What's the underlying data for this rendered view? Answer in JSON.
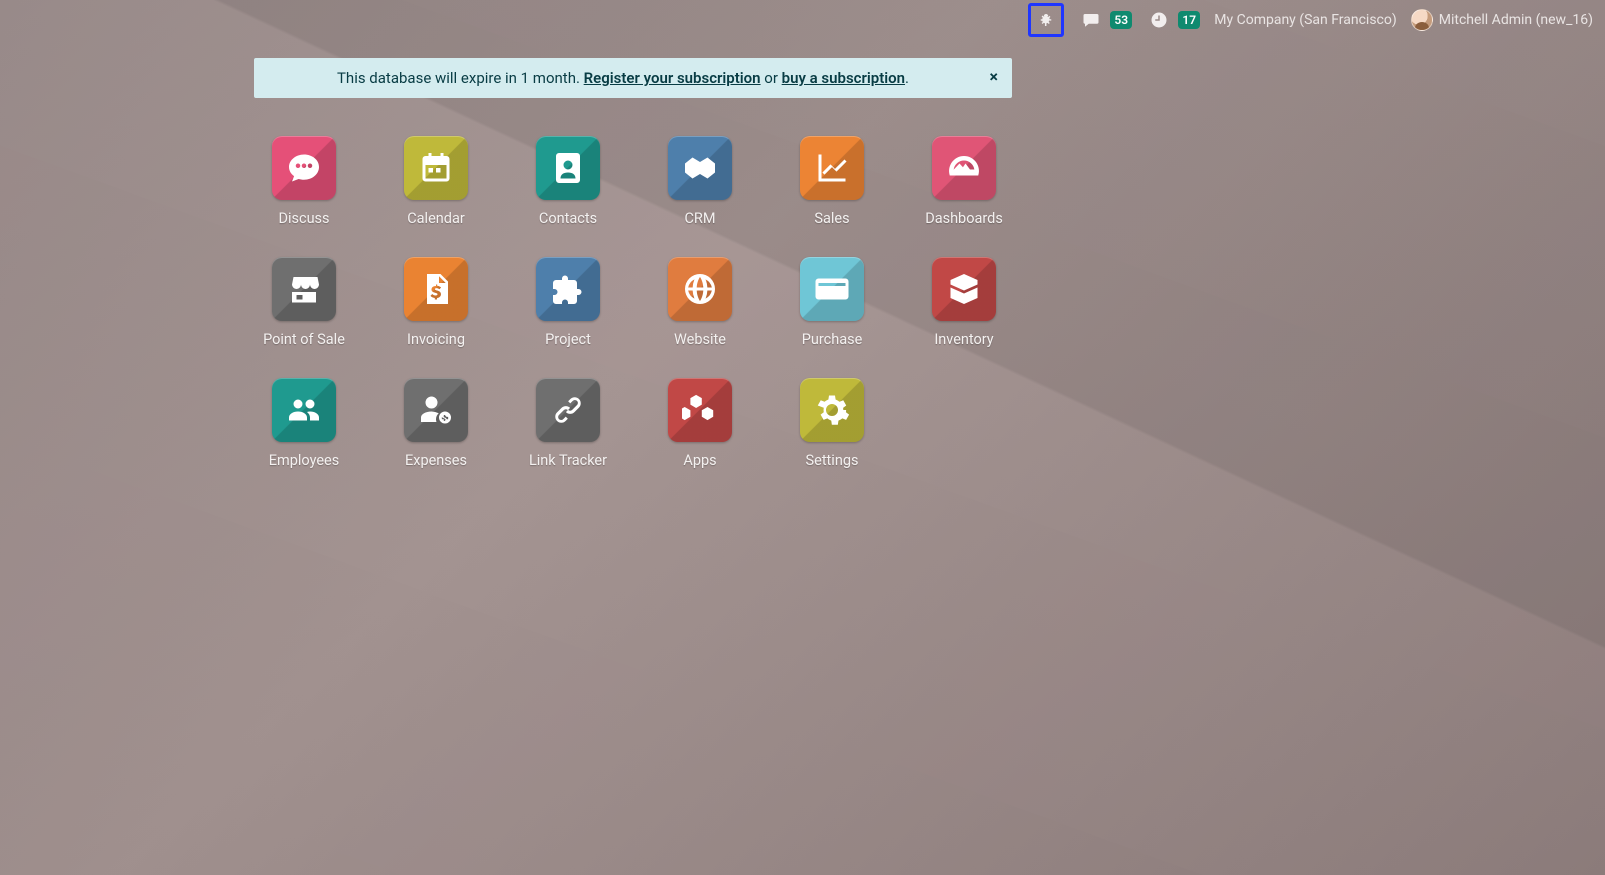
{
  "navbar": {
    "messages_badge": "53",
    "activities_badge": "17",
    "company": "My Company (San Francisco)",
    "user": "Mitchell Admin (new_16)"
  },
  "banner": {
    "prefix": "This database will expire in 1 month. ",
    "link1": "Register your subscription",
    "middle": " or ",
    "link2": "buy a subscription",
    "suffix": ".",
    "close": "×"
  },
  "apps": [
    {
      "label": "Discuss",
      "color": "#e55078",
      "icon": "chat"
    },
    {
      "label": "Calendar",
      "color": "#bfb93a",
      "icon": "calendar"
    },
    {
      "label": "Contacts",
      "color": "#1f9a8f",
      "icon": "contacts"
    },
    {
      "label": "CRM",
      "color": "#4e7fab",
      "icon": "handshake"
    },
    {
      "label": "Sales",
      "color": "#ec8434",
      "icon": "linechart"
    },
    {
      "label": "Dashboards",
      "color": "#e05576",
      "icon": "gauge"
    },
    {
      "label": "Point of Sale",
      "color": "#6f6f6f",
      "icon": "shop"
    },
    {
      "label": "Invoicing",
      "color": "#ea8332",
      "icon": "invoice"
    },
    {
      "label": "Project",
      "color": "#4e7fab",
      "icon": "puzzle"
    },
    {
      "label": "Website",
      "color": "#e07c3f",
      "icon": "globe"
    },
    {
      "label": "Purchase",
      "color": "#6fc6d6",
      "icon": "card"
    },
    {
      "label": "Inventory",
      "color": "#c14846",
      "icon": "box"
    },
    {
      "label": "Employees",
      "color": "#1f9a8f",
      "icon": "people"
    },
    {
      "label": "Expenses",
      "color": "#6f6f6f",
      "icon": "expense"
    },
    {
      "label": "Link Tracker",
      "color": "#6f6f6f",
      "icon": "link"
    },
    {
      "label": "Apps",
      "color": "#c14846",
      "icon": "cubes"
    },
    {
      "label": "Settings",
      "color": "#bfb93a",
      "icon": "gear"
    }
  ]
}
